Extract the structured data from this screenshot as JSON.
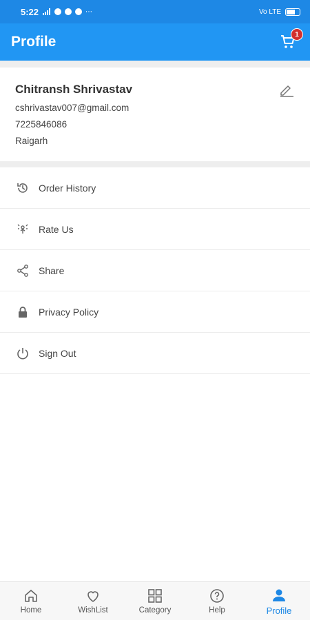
{
  "status_bar": {
    "time": "5:22",
    "carrier": "Vo LTE"
  },
  "app_bar": {
    "title": "Profile",
    "cart_count": "1"
  },
  "profile": {
    "name": "Chitransh Shrivastav",
    "email": "cshrivastav007@gmail.com",
    "phone": "7225846086",
    "city": "Raigarh"
  },
  "menu": [
    {
      "label": "Order History",
      "icon": "history-icon"
    },
    {
      "label": "Rate Us",
      "icon": "rate-icon"
    },
    {
      "label": "Share",
      "icon": "share-icon"
    },
    {
      "label": "Privacy Policy",
      "icon": "lock-icon"
    },
    {
      "label": "Sign Out",
      "icon": "power-icon"
    }
  ],
  "bottom_nav": [
    {
      "label": "Home",
      "icon": "home-icon"
    },
    {
      "label": "WishList",
      "icon": "heart-icon"
    },
    {
      "label": "Category",
      "icon": "grid-icon"
    },
    {
      "label": "Help",
      "icon": "help-icon"
    },
    {
      "label": "Profile",
      "icon": "person-icon",
      "active": true
    }
  ],
  "colors": {
    "primary": "#2196f3",
    "status_bar": "#1e88e5",
    "badge": "#d32f2f",
    "active_nav": "#1e88e5"
  }
}
